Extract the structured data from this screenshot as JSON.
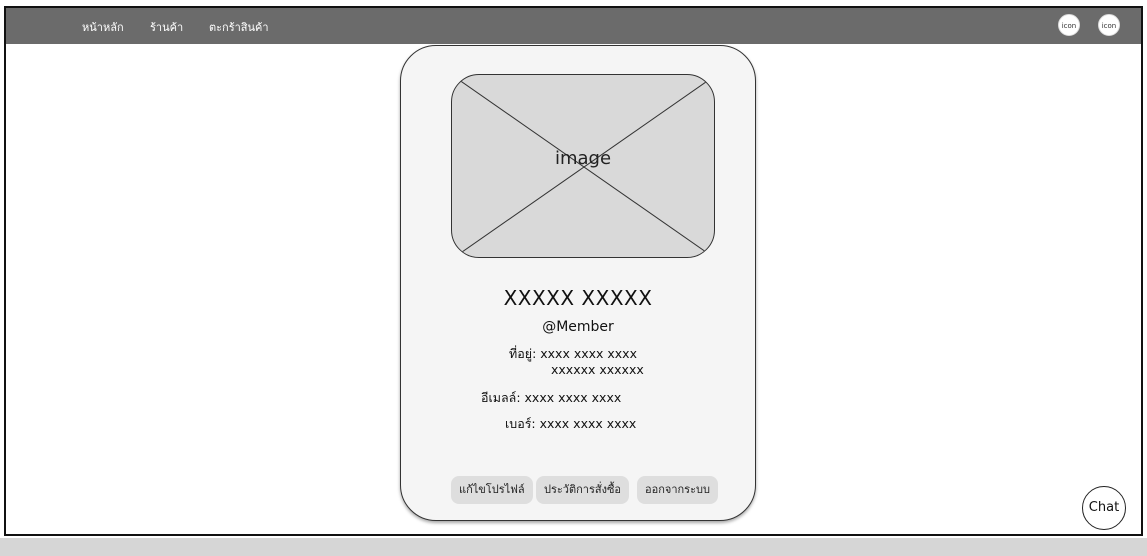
{
  "nav": {
    "links": [
      {
        "label": "หน้าหลัก"
      },
      {
        "label": "ร้านค้า"
      },
      {
        "label": "ตะกร้าสินค้า"
      }
    ],
    "icons": [
      {
        "label": "icon"
      },
      {
        "label": "icon"
      }
    ]
  },
  "profile": {
    "image_label": "image",
    "name": "XXXXX XXXXX",
    "role": "@Member",
    "address_line1": "ที่อยู่: xxxx xxxx xxxx",
    "address_line2": "xxxxxx  xxxxxx",
    "email": "อีเมลล์: xxxx xxxx xxxx",
    "phone": "เบอร์: xxxx xxxx xxxx"
  },
  "actions": {
    "edit_profile": "แก้ไขโปรไฟล์",
    "order_history": "ประวัติการสั่งซื้อ",
    "logout": "ออกจากระบบ"
  },
  "chat": {
    "label": "Chat"
  }
}
